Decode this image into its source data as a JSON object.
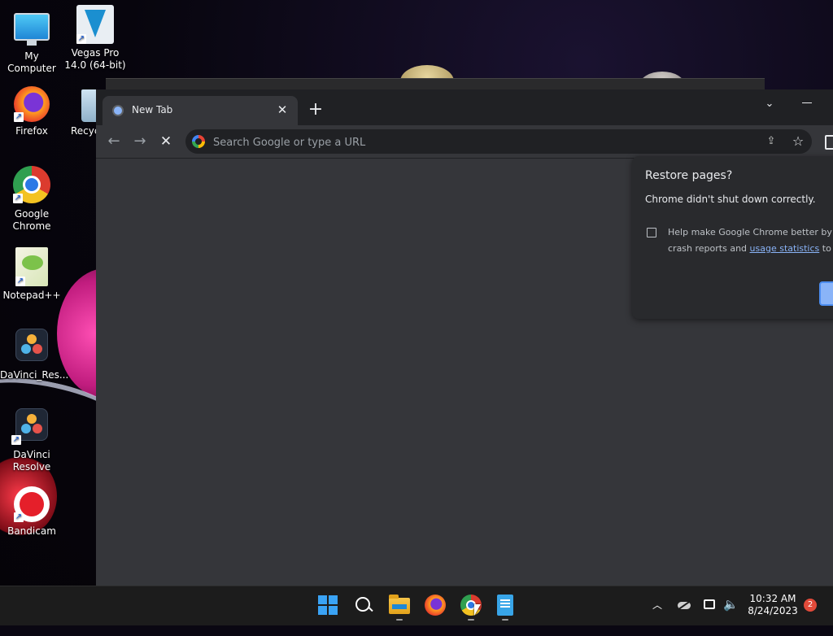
{
  "desktop": {
    "icons": [
      {
        "label": "My Computer"
      },
      {
        "label": "Vegas Pro 14.0 (64-bit)"
      },
      {
        "label": "Firefox"
      },
      {
        "label": "Recyc"
      },
      {
        "label": "Google Chrome"
      },
      {
        "label": "Notepad++"
      },
      {
        "label": "DaVinci_Res..."
      },
      {
        "label": "DaVinci Resolve"
      },
      {
        "label": "Bandicam"
      }
    ]
  },
  "browser": {
    "tab": {
      "title": "New Tab"
    },
    "toolbar": {
      "omnibox_placeholder": "Search Google or type a URL"
    },
    "restore_bubble": {
      "title": "Restore pages?",
      "message": "Chrome didn't shut down correctly.",
      "help_line1": "Help make Google Chrome better by s",
      "help_line2_prefix": "crash reports and ",
      "help_link": "usage statistics",
      "help_line2_suffix": " to G"
    },
    "theme": {
      "frame": "#202124",
      "toolbar": "#35363a",
      "accent": "#8ab4f8"
    }
  },
  "taskbar": {
    "clock_time": "10:32 AM",
    "clock_date": "8/24/2023",
    "notification_count": "2",
    "pinned": [
      "start-icon",
      "search-icon",
      "file-explorer-icon",
      "firefox-icon",
      "chrome-icon",
      "notepad-icon"
    ]
  }
}
